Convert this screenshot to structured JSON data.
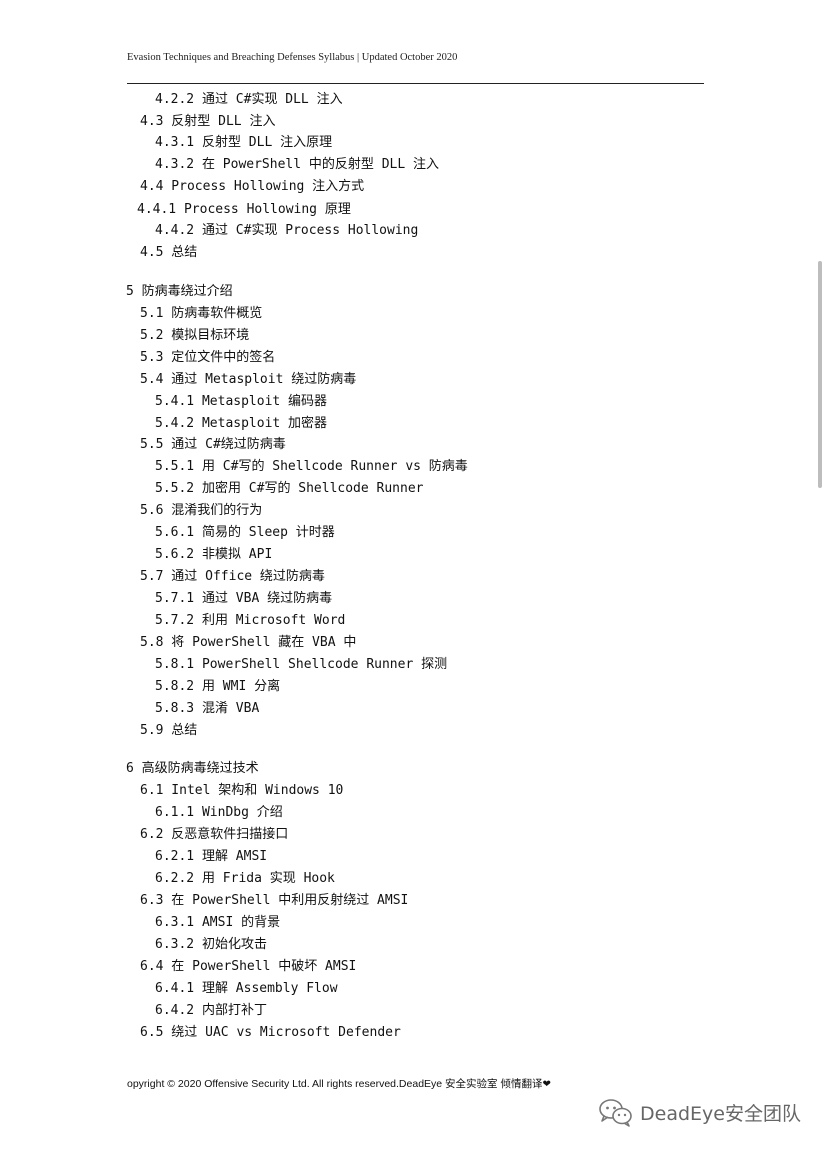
{
  "header": {
    "text": "Evasion Techniques and Breaching Defenses Syllabus | Updated October 2020"
  },
  "toc": [
    "4.2.2 通过 C#实现 DLL 注入",
    "4.3 反射型 DLL 注入",
    "4.3.1 反射型 DLL 注入原理",
    "4.3.2 在 PowerShell 中的反射型 DLL 注入",
    "4.4 Process Hollowing 注入方式",
    "4.4.1 Process Hollowing 原理",
    "4.4.2 通过 C#实现 Process Hollowing",
    "4.5 总结",
    "5 防病毒绕过介绍",
    "5.1 防病毒软件概览",
    "5.2 模拟目标环境",
    "5.3 定位文件中的签名",
    "5.4 通过 Metasploit 绕过防病毒",
    "5.4.1 Metasploit 编码器",
    "5.4.2 Metasploit 加密器",
    "5.5 通过 C#绕过防病毒",
    "5.5.1 用 C#写的 Shellcode Runner vs 防病毒",
    "5.5.2 加密用 C#写的 Shellcode Runner",
    "5.6 混淆我们的行为",
    "5.6.1 简易的 Sleep 计时器",
    "5.6.2 非模拟 API",
    "5.7 通过 Office 绕过防病毒",
    "5.7.1 通过 VBA 绕过防病毒",
    "5.7.2 利用 Microsoft Word",
    "5.8 将 PowerShell 藏在 VBA 中",
    "5.8.1 PowerShell Shellcode Runner 探测",
    "5.8.2 用 WMI 分离",
    "5.8.3 混淆 VBA",
    "5.9 总结",
    "6 高级防病毒绕过技术",
    "6.1 Intel 架构和 Windows 10",
    "6.1.1 WinDbg 介绍",
    "6.2 反恶意软件扫描接口",
    "6.2.1 理解 AMSI",
    "6.2.2 用 Frida 实现 Hook",
    "6.3 在 PowerShell 中利用反射绕过 AMSI",
    "6.3.1 AMSI 的背景",
    "6.3.2 初始化攻击",
    "6.4 在 PowerShell 中破坏 AMSI",
    "6.4.1 理解 Assembly Flow",
    "6.4.2 内部打补丁",
    "6.5 绕过 UAC vs Microsoft Defender"
  ],
  "footer": {
    "text": "opyright © 2020 Offensive Security Ltd. All rights reserved.DeadEye 安全实验室  倾情翻译",
    "heart": "❤"
  },
  "watermark": {
    "text": "DeadEye安全团队",
    "icon": "wechat-icon"
  }
}
